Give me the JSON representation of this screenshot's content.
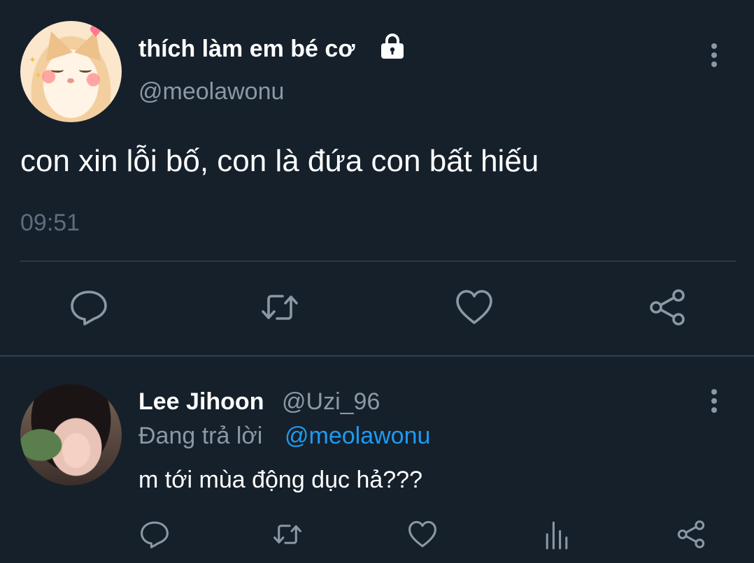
{
  "colors": {
    "background": "#15202b",
    "text_primary": "#ffffff",
    "text_secondary": "#8b98a5",
    "timestamp": "#5e6d7d",
    "icon": "#8b98a5",
    "link": "#1d9bf0",
    "divider": "#2a3744"
  },
  "tweet": {
    "display_name": "thích làm em bé cơ",
    "handle": "@meolawonu",
    "text": "con xin lỗi bố, con là đứa con bất hiếu",
    "time": "09:51",
    "icons": {
      "lock": "lock-icon",
      "more": "more-vertical-icon",
      "reply": "reply-icon",
      "retweet": "retweet-icon",
      "like": "heart-icon",
      "share": "share-icon"
    }
  },
  "reply": {
    "display_name": "Lee Jihoon",
    "handle": "@Uzi_96",
    "replying_prefix": "Đang trả lời",
    "replying_mention": "@meolawonu",
    "text": "m tới mùa động dục hả???",
    "icons": {
      "more": "more-vertical-icon",
      "reply": "reply-icon",
      "retweet": "retweet-icon",
      "like": "heart-icon",
      "analytics": "analytics-icon",
      "share": "share-icon"
    }
  }
}
